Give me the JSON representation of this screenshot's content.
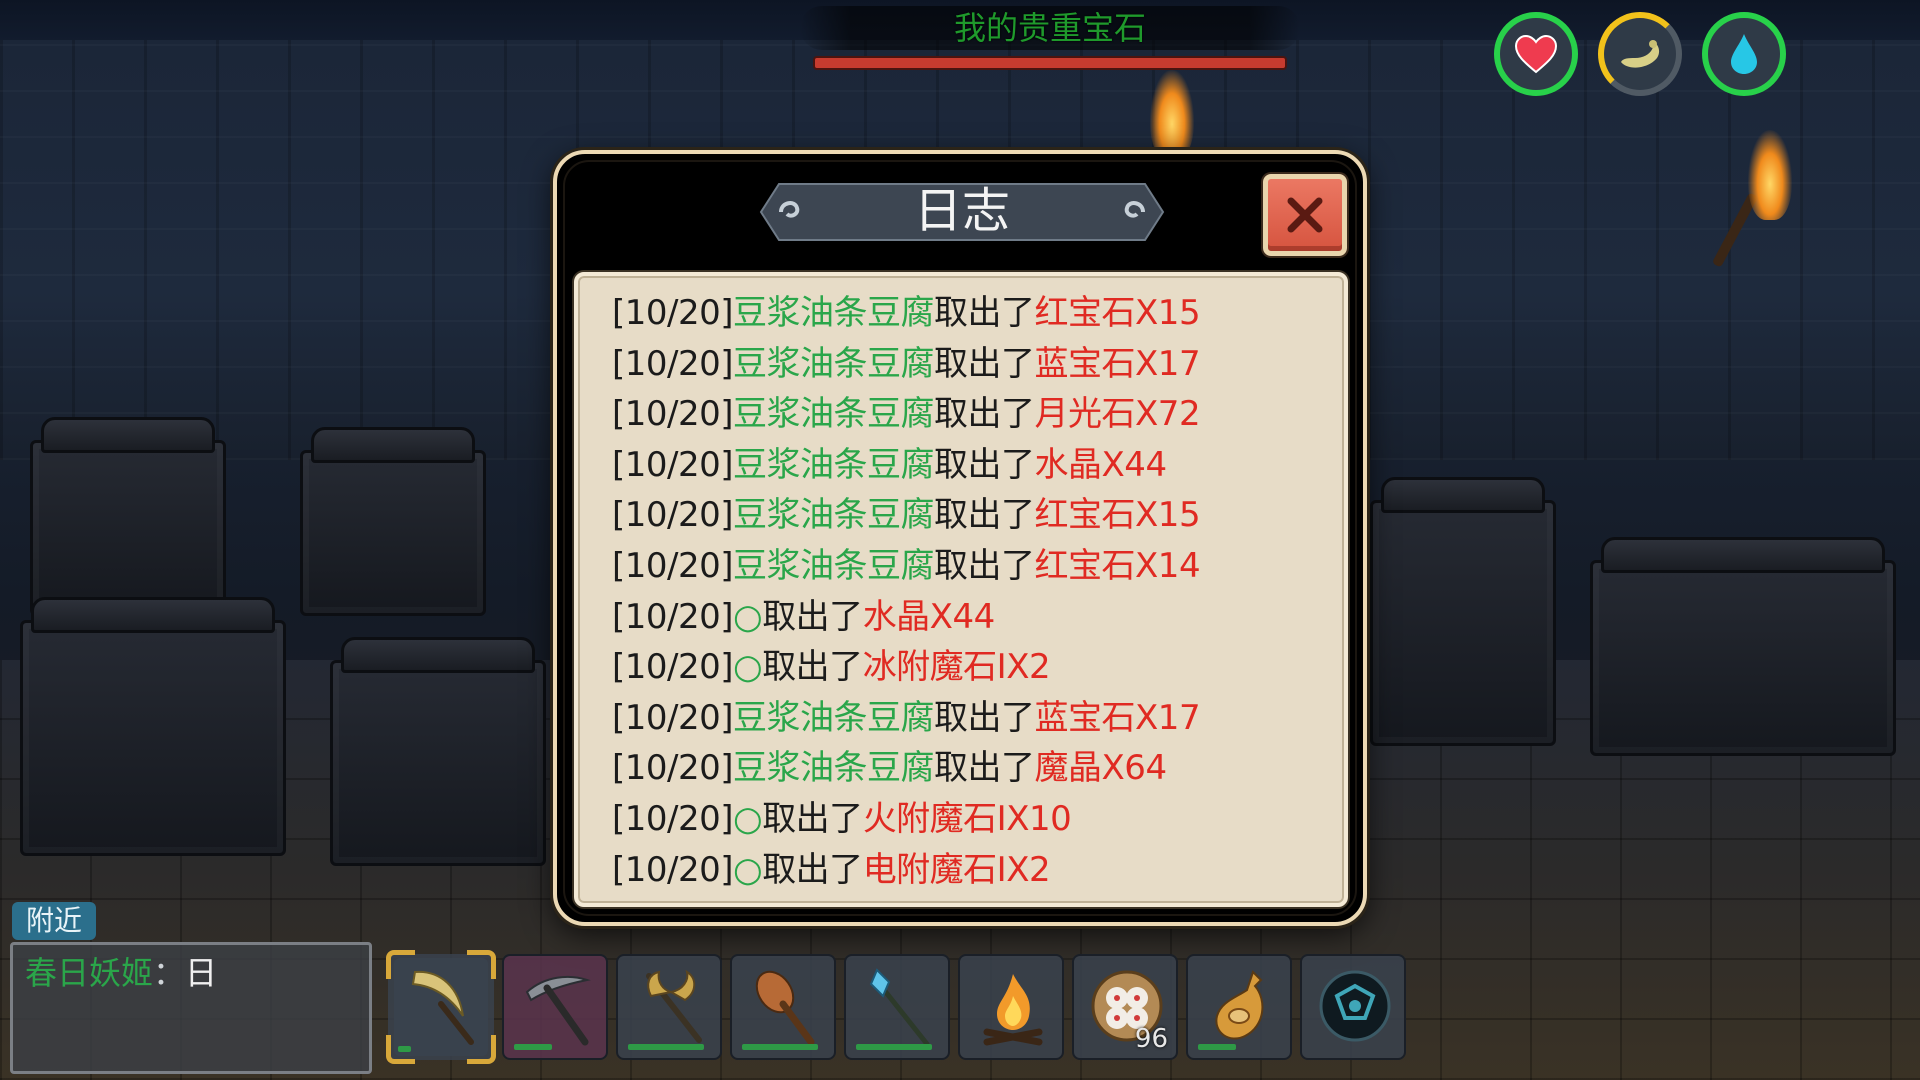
{
  "hud": {
    "quest_title": "我的贵重宝石",
    "stats": [
      {
        "name": "health",
        "icon": "heart-icon",
        "color": "#28d14a"
      },
      {
        "name": "hunger",
        "icon": "food-icon",
        "color": "#f2c21b"
      },
      {
        "name": "thirst",
        "icon": "water-drop-icon",
        "color": "#28d14a"
      }
    ]
  },
  "log_dialog": {
    "title": "日志",
    "close_icon": "close-icon",
    "entries": [
      {
        "date": "[10/20]",
        "player": "豆浆油条豆腐",
        "verb": "取出了",
        "item": "红宝石X15"
      },
      {
        "date": "[10/20]",
        "player": "豆浆油条豆腐",
        "verb": "取出了",
        "item": "蓝宝石X17"
      },
      {
        "date": "[10/20]",
        "player": "豆浆油条豆腐",
        "verb": "取出了",
        "item": "月光石X72"
      },
      {
        "date": "[10/20]",
        "player": "豆浆油条豆腐",
        "verb": "取出了",
        "item": "水晶X44"
      },
      {
        "date": "[10/20]",
        "player": "豆浆油条豆腐",
        "verb": "取出了",
        "item": "红宝石X15"
      },
      {
        "date": "[10/20]",
        "player": "豆浆油条豆腐",
        "verb": "取出了",
        "item": "红宝石X14"
      },
      {
        "date": "[10/20]",
        "player": "○",
        "verb": "取出了",
        "item": "水晶X44"
      },
      {
        "date": "[10/20]",
        "player": "○",
        "verb": "取出了",
        "item": "冰附魔石IX2"
      },
      {
        "date": "[10/20]",
        "player": "豆浆油条豆腐",
        "verb": "取出了",
        "item": "蓝宝石X17"
      },
      {
        "date": "[10/20]",
        "player": "豆浆油条豆腐",
        "verb": "取出了",
        "item": "魔晶X64"
      },
      {
        "date": "[10/20]",
        "player": "○",
        "verb": "取出了",
        "item": "火附魔石IX10"
      },
      {
        "date": "[10/20]",
        "player": "○",
        "verb": "取出了",
        "item": "电附魔石IX2"
      }
    ]
  },
  "chat": {
    "tab_label": "附近",
    "messages": [
      {
        "sender": "春日妖姬",
        "separator": "：",
        "text": "日"
      }
    ]
  },
  "hotbar": {
    "slots": [
      {
        "icon": "scythe-icon",
        "selected": true,
        "durability": 0.15
      },
      {
        "icon": "pickaxe-icon",
        "selected": false,
        "durability": 0.45
      },
      {
        "icon": "battle-axe-icon",
        "selected": false,
        "durability": 0.9
      },
      {
        "icon": "club-icon",
        "selected": false,
        "durability": 0.9
      },
      {
        "icon": "crystal-staff-icon",
        "selected": false,
        "durability": 0.9
      },
      {
        "icon": "campfire-icon",
        "selected": false
      },
      {
        "icon": "steamed-buns-icon",
        "selected": false,
        "count": "96"
      },
      {
        "icon": "water-gourd-icon",
        "selected": false,
        "durability": 0.45
      },
      {
        "icon": "dark-orb-icon",
        "selected": false
      }
    ]
  }
}
